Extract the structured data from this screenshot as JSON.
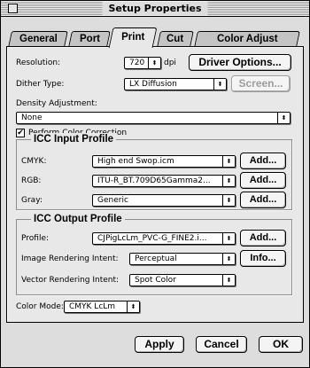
{
  "window": {
    "title": "Setup Properties"
  },
  "tabs": [
    {
      "label": "General",
      "active": false
    },
    {
      "label": "Port",
      "active": false
    },
    {
      "label": "Print",
      "active": true
    },
    {
      "label": "Cut",
      "active": false
    },
    {
      "label": "Color Adjust",
      "active": false
    }
  ],
  "resolution": {
    "label": "Resolution:",
    "value": "720",
    "unit": "dpi"
  },
  "driver_options": {
    "label": "Driver Options..."
  },
  "dither": {
    "label": "Dither Type:",
    "value": "LX Diffusion"
  },
  "screen_button": {
    "label": "Screen...",
    "enabled": false
  },
  "density": {
    "label": "Density Adjustment:",
    "value": "None"
  },
  "color_correction": {
    "label": "Perform Color Correction",
    "checked": true,
    "check_glyph": "✔"
  },
  "icc_input": {
    "title": "ICC Input Profile",
    "cmyk": {
      "label": "CMYK:",
      "value": "High end Swop.icm",
      "button": "Add..."
    },
    "rgb": {
      "label": "RGB:",
      "value": "ITU-R_BT.709D65Gamma2...",
      "button": "Add..."
    },
    "gray": {
      "label": "Gray:",
      "value": "Generic",
      "button": "Add..."
    }
  },
  "icc_output": {
    "title": "ICC Output Profile",
    "profile": {
      "label": "Profile:",
      "value": "CJPigLcLm_PVC-G_FINE2.i...",
      "button": "Add..."
    },
    "image_intent": {
      "label": "Image Rendering Intent:",
      "value": "Perceptual",
      "button": "Info..."
    },
    "vector_intent": {
      "label": "Vector Rendering Intent:",
      "value": "Spot Color"
    }
  },
  "color_mode": {
    "label": "Color Mode:",
    "value": "CMYK LcLm"
  },
  "footer": {
    "apply": "Apply",
    "cancel": "Cancel",
    "ok": "OK"
  },
  "icons": {
    "popup_arrow": "⬍",
    "stepper_arrow": "⬍"
  }
}
